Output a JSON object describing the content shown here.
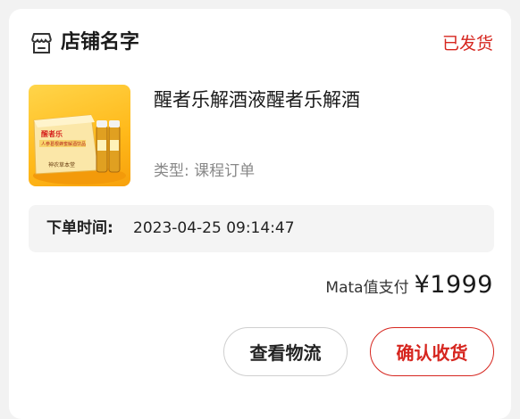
{
  "shop": {
    "icon": "store-icon",
    "name": "店铺名字",
    "status": "已发货"
  },
  "product": {
    "image_icon": "product-thumbnail",
    "title": "醒者乐解酒液醒者乐解酒",
    "type_label": "类型:",
    "type_value": "课程订单",
    "image_brand": "醒者乐",
    "image_caption": "人参葛根蜂蜜解酒饮品",
    "image_seal": "神农草本堂"
  },
  "order": {
    "time_label": "下单时间:",
    "time_value": "2023-04-25 09:14:47"
  },
  "payment": {
    "label": "Mata值支付",
    "amount": "¥1999"
  },
  "actions": {
    "logistics": "查看物流",
    "confirm": "确认收货"
  },
  "colors": {
    "accent": "#d6261f",
    "background": "#f2f2f2",
    "card": "#ffffff"
  }
}
